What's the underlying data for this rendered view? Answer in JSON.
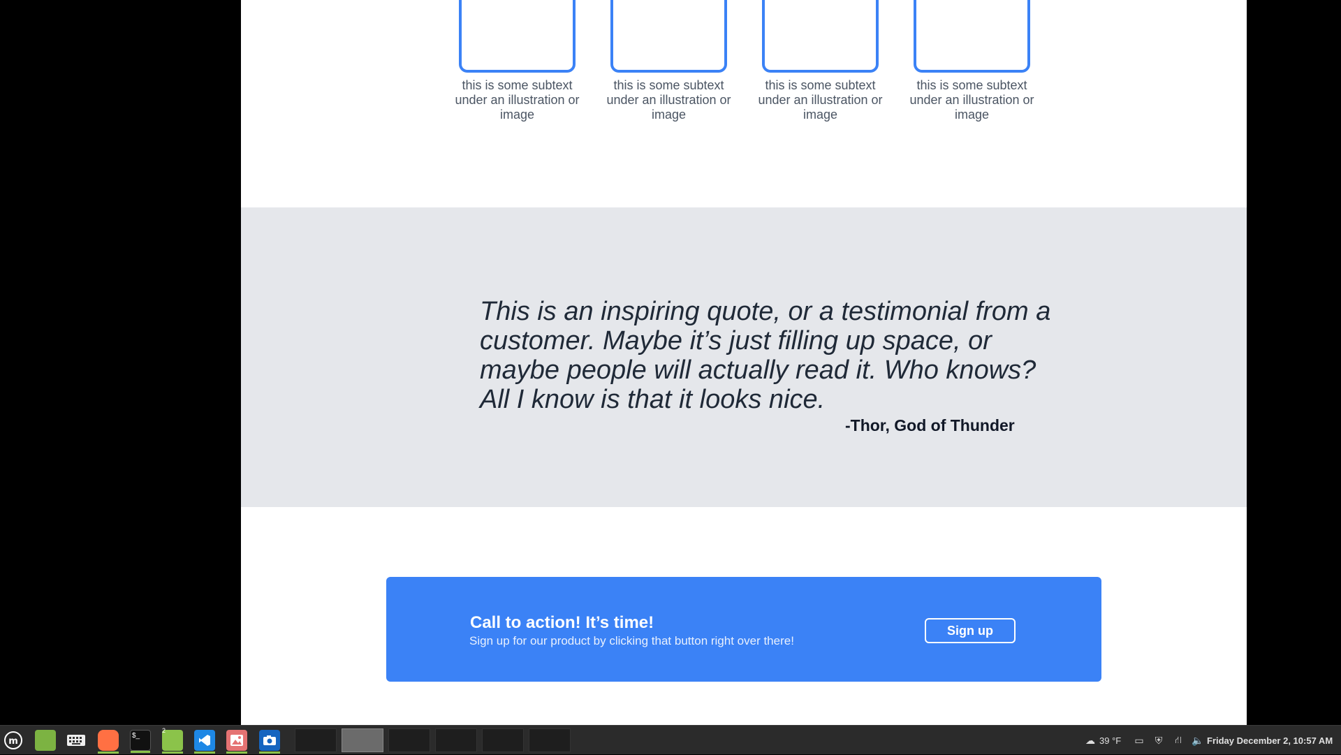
{
  "cards": [
    {
      "subtext": "this is some subtext under an illustration or image"
    },
    {
      "subtext": "this is some subtext under an illustration or image"
    },
    {
      "subtext": "this is some subtext under an illustration or image"
    },
    {
      "subtext": "this is some subtext under an illustration or image"
    }
  ],
  "quote": {
    "text": "This is an inspiring quote, or a testimonial from a customer.  Maybe it’s just filling up space, or maybe people will actually read it. Who knows?  All I know is that it looks nice.",
    "author": "-Thor, God of Thunder"
  },
  "cta": {
    "title": "Call to action! It’s time!",
    "subtitle": "Sign up for our product by clicking that button right over there!",
    "button_label": "Sign up"
  },
  "taskbar": {
    "apps": [
      {
        "name": "mint-menu-icon"
      },
      {
        "name": "files-icon"
      },
      {
        "name": "keyboard-icon"
      },
      {
        "name": "firefox-icon"
      },
      {
        "name": "terminal-icon"
      },
      {
        "name": "folder-icon",
        "badge": "2"
      },
      {
        "name": "vscode-icon"
      },
      {
        "name": "image-viewer-icon"
      },
      {
        "name": "screenshot-icon"
      }
    ],
    "weather": "39 °F",
    "clock": "Friday December  2, 10:57 AM"
  },
  "colors": {
    "accent": "#3b82f6",
    "quote_band": "#e5e7eb",
    "taskbar": "#2b2b2b"
  }
}
